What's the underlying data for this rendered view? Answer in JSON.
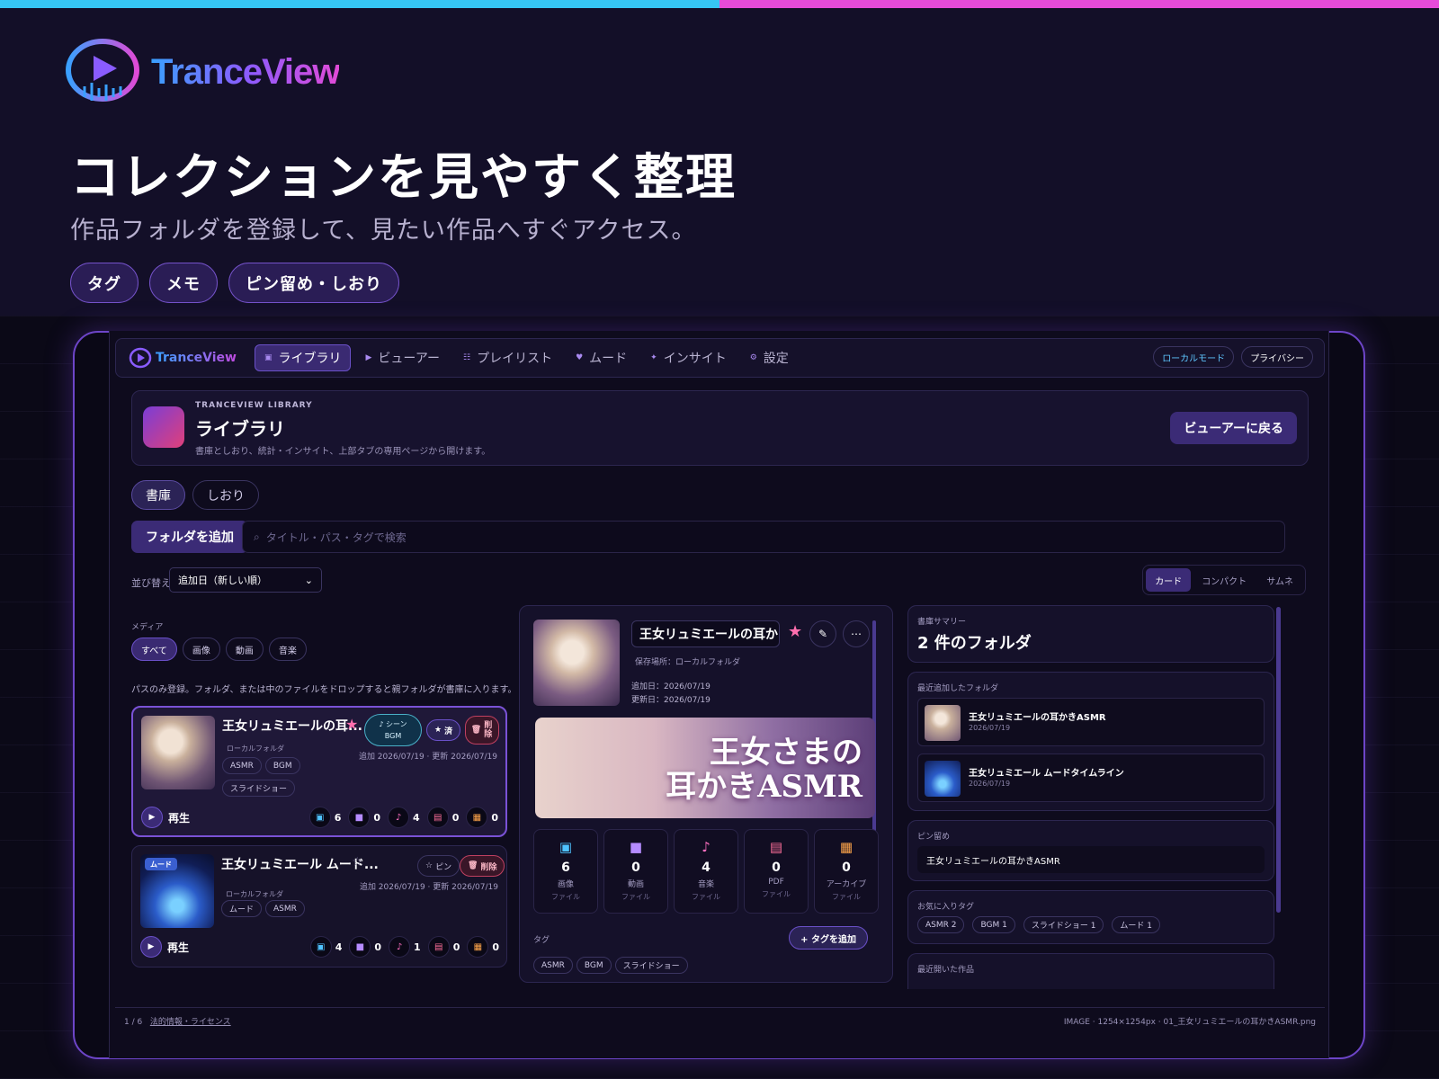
{
  "colors": {
    "accent_blue": "#36c6f4",
    "accent_pink": "#e64bd9",
    "accent_purple": "#6d45c8",
    "star": "#ff6fae"
  },
  "brand": {
    "name": "TranceView"
  },
  "hero": {
    "title": "コレクションを見やすく整理",
    "subtitle": "作品フォルダを登録して、見たい作品へすぐアクセス。",
    "chips": [
      "タグ",
      "メモ",
      "ピン留め・しおり"
    ]
  },
  "nav": {
    "brand": "TranceView",
    "tabs": [
      {
        "label": "ライブラリ",
        "icon": "library-icon",
        "active": true
      },
      {
        "label": "ビューアー",
        "icon": "play-icon"
      },
      {
        "label": "プレイリスト",
        "icon": "list-icon"
      },
      {
        "label": "ムード",
        "icon": "heart-icon"
      },
      {
        "label": "インサイト",
        "icon": "sparkle-icon"
      },
      {
        "label": "設定",
        "icon": "gear-icon"
      }
    ],
    "local_mode": "ローカルモード",
    "privacy": "プライバシー"
  },
  "library_header": {
    "kicker": "TRANCEVIEW LIBRARY",
    "title": "ライブラリ",
    "description": "書庫としおり、統計・インサイト、上部タブの専用ページから開けます。",
    "back_button": "ビューアーに戻る"
  },
  "segments": [
    "書庫",
    "しおり"
  ],
  "toolbar": {
    "add_folder": "フォルダを追加",
    "search_placeholder": "タイトル・パス・タグで検索",
    "sort_label": "並び替え",
    "sort_value": "追加日（新しい順）",
    "view_modes": [
      {
        "label": "カード",
        "active": true
      },
      {
        "label": "コンパクト"
      },
      {
        "label": "サムネ"
      }
    ]
  },
  "media_filter": {
    "label": "メディア",
    "options": [
      {
        "label": "すべて",
        "active": true
      },
      {
        "label": "画像"
      },
      {
        "label": "動画"
      },
      {
        "label": "音楽"
      }
    ]
  },
  "drop_hint": "パスのみ登録。フォルダ、または中のファイルをドロップすると親フォルダが書庫に入ります。",
  "cards": [
    {
      "title": "王女リュミエールの耳...",
      "favorite": true,
      "location": "ローカルフォルダ",
      "tags": [
        "ASMR",
        "BGM",
        "スライドショー"
      ],
      "scene_label_1": "♪ シーン",
      "scene_label_2": "BGM",
      "done_label": "済",
      "delete_label": "削除",
      "dates": "追加 2026/07/19 · 更新 2026/07/19",
      "play_label": "再生",
      "counts": {
        "image": 6,
        "video": 0,
        "music": 4,
        "pdf": 0,
        "archive": 0
      }
    },
    {
      "title": "王女リュミエール ムード...",
      "favorite": false,
      "badge": "ムード",
      "location": "ローカルフォルダ",
      "tags": [
        "ムード",
        "ASMR"
      ],
      "pin_label": "ピン",
      "delete_label": "削除",
      "dates": "追加 2026/07/19 · 更新 2026/07/19",
      "play_label": "再生",
      "counts": {
        "image": 4,
        "video": 0,
        "music": 1,
        "pdf": 0,
        "archive": 0
      }
    }
  ],
  "detail": {
    "title": "王女リュミエールの耳かきA",
    "location": "保存場所：ローカルフォルダ",
    "added": "追加日：2026/07/19",
    "updated": "更新日：2026/07/19",
    "banner_line1": "王女さまの",
    "banner_line2": "耳かきASMR",
    "stats": [
      {
        "icon": "image-icon",
        "value": "6",
        "label": "画像",
        "unit": "ファイル",
        "color": "#4fc3ff"
      },
      {
        "icon": "video-icon",
        "value": "0",
        "label": "動画",
        "unit": "ファイル",
        "color": "#b68cff"
      },
      {
        "icon": "music-icon",
        "value": "4",
        "label": "音楽",
        "unit": "ファイル",
        "color": "#ff6fc1"
      },
      {
        "icon": "pdf-icon",
        "value": "0",
        "label": "PDF",
        "unit": "ファイル",
        "color": "#ff6f9a"
      },
      {
        "icon": "archive-icon",
        "value": "0",
        "label": "アーカイブ",
        "unit": "ファイル",
        "color": "#ffa54a"
      }
    ],
    "tags_label": "タグ",
    "add_tag": "+ タグを追加",
    "tags": [
      "ASMR",
      "BGM",
      "スライドショー"
    ]
  },
  "sidebar": {
    "summary_label": "書庫サマリー",
    "summary_value": "2 件のフォルダ",
    "recent_label": "最近追加したフォルダ",
    "recent": [
      {
        "name": "王女リュミエールの耳かきASMR",
        "date": "2026/07/19"
      },
      {
        "name": "王女リュミエール ムードタイムライン",
        "date": "2026/07/19"
      }
    ],
    "pinned_label": "ピン留め",
    "pinned": "王女リュミエールの耳かきASMR",
    "fav_tags_label": "お気に入りタグ",
    "fav_tags": [
      "ASMR 2",
      "BGM 1",
      "スライドショー 1",
      "ムード 1"
    ],
    "recent_opened_label": "最近開いた作品"
  },
  "footer": {
    "page": "1 / 6",
    "legal": "法的情報・ライセンス",
    "image_info": "IMAGE · 1254×1254px · 01_王女リュミエールの耳かきASMR.png"
  }
}
